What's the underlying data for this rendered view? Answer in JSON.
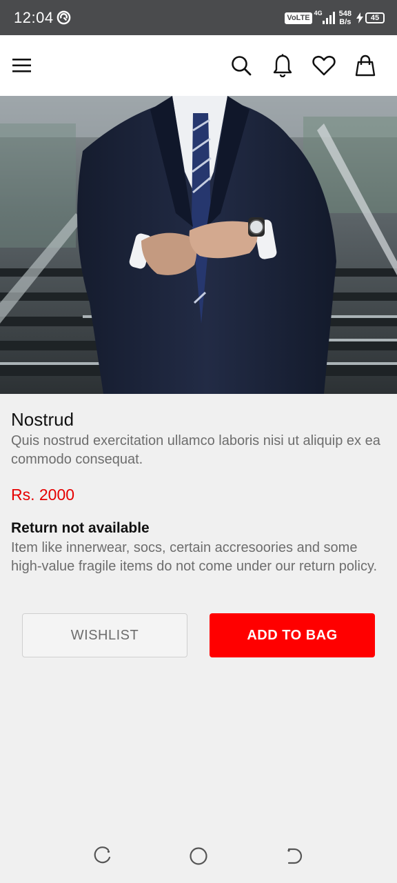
{
  "status_bar": {
    "time": "12:04",
    "volte": "VoLTE",
    "network": "4G",
    "speed_value": "548",
    "speed_unit": "B/s",
    "battery": "45"
  },
  "app_bar": {
    "icons": [
      "menu-icon",
      "search-icon",
      "bell-icon",
      "heart-icon",
      "shopping-bag-icon"
    ]
  },
  "product": {
    "title": "Nostrud",
    "description": "Quis nostrud exercitation ullamco laboris nisi ut aliquip ex ea commodo consequat.",
    "price": "Rs. 2000",
    "return_title": "Return not available",
    "return_description": "Item like innerwear, socs, certain accresoories and some high-value fragile items do not come under our return policy."
  },
  "actions": {
    "wishlist_label": "WISHLIST",
    "add_to_bag_label": "ADD TO BAG"
  },
  "colors": {
    "accent": "#ff0000",
    "status_bar": "#4a4b4d",
    "background": "#f0f0f0"
  },
  "nav_bar": {
    "icons": [
      "recent-apps-icon",
      "home-icon",
      "back-icon"
    ]
  }
}
